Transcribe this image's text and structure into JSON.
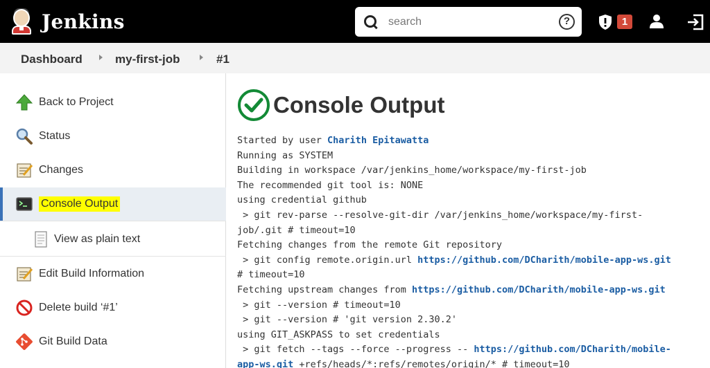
{
  "header": {
    "brand": "Jenkins",
    "search_placeholder": "search",
    "help_label": "?",
    "security_count": "1"
  },
  "breadcrumb": [
    "Dashboard",
    "my-first-job",
    "#1"
  ],
  "sidebar": {
    "items": [
      {
        "label": "Back to Project",
        "icon": "up-arrow-icon"
      },
      {
        "label": "Status",
        "icon": "magnifier-icon"
      },
      {
        "label": "Changes",
        "icon": "notepad-icon"
      },
      {
        "label": "Console Output",
        "icon": "terminal-icon"
      },
      {
        "label": "View as plain text",
        "icon": "document-icon"
      },
      {
        "label": "Edit Build Information",
        "icon": "notepad-icon"
      },
      {
        "label": "Delete build ‘#1’",
        "icon": "no-entry-icon"
      },
      {
        "label": "Git Build Data",
        "icon": "git-icon"
      }
    ]
  },
  "main": {
    "title": "Console Output",
    "lines": [
      {
        "text": "Started by user ",
        "link": "Charith Epitawatta",
        "after": ""
      },
      {
        "text": "Running as SYSTEM",
        "link": "",
        "after": ""
      },
      {
        "text": "Building in workspace /var/jenkins_home/workspace/my-first-job",
        "link": "",
        "after": ""
      },
      {
        "text": "The recommended git tool is: NONE",
        "link": "",
        "after": ""
      },
      {
        "text": "using credential github",
        "link": "",
        "after": ""
      },
      {
        "text": " > git rev-parse --resolve-git-dir /var/jenkins_home/workspace/my-first-",
        "link": "",
        "after": ""
      },
      {
        "text": "job/.git # timeout=10",
        "link": "",
        "after": ""
      },
      {
        "text": "Fetching changes from the remote Git repository",
        "link": "",
        "after": ""
      },
      {
        "text": " > git config remote.origin.url ",
        "link": "https://github.com/DCharith/mobile-app-ws.git",
        "after": ""
      },
      {
        "text": "# timeout=10",
        "link": "",
        "after": ""
      },
      {
        "text": "Fetching upstream changes from ",
        "link": "https://github.com/DCharith/mobile-app-ws.git",
        "after": ""
      },
      {
        "text": " > git --version # timeout=10",
        "link": "",
        "after": ""
      },
      {
        "text": " > git --version # 'git version 2.30.2'",
        "link": "",
        "after": ""
      },
      {
        "text": "using GIT_ASKPASS to set credentials",
        "link": "",
        "after": ""
      },
      {
        "text": " > git fetch --tags --force --progress -- ",
        "link": "https://github.com/DCharith/mobile-",
        "after": ""
      },
      {
        "text": "",
        "link": "app-ws.git",
        "after": " +refs/heads/*:refs/remotes/origin/* # timeout=10"
      }
    ]
  }
}
